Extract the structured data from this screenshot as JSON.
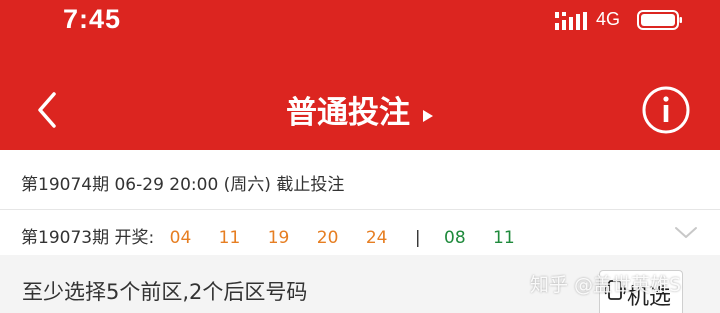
{
  "status": {
    "time": "7:45",
    "network": "4G"
  },
  "nav": {
    "title": "普通投注"
  },
  "deadline": {
    "text": "第19074期 06-29 20:00 (周六) 截止投注"
  },
  "draw": {
    "label": "第19073期 开奖:",
    "front": [
      "04",
      "11",
      "19",
      "20",
      "24"
    ],
    "separator": "|",
    "back": [
      "08",
      "11"
    ]
  },
  "instruction": {
    "text": "至少选择5个前区,2个后区号码"
  },
  "watermark": {
    "text": "知乎 @盖世英雄S"
  },
  "random": {
    "label": "机选"
  },
  "colors": {
    "brand_red": "#dc2520",
    "front_ball": "#e67e22",
    "back_ball": "#1f8a3c"
  }
}
